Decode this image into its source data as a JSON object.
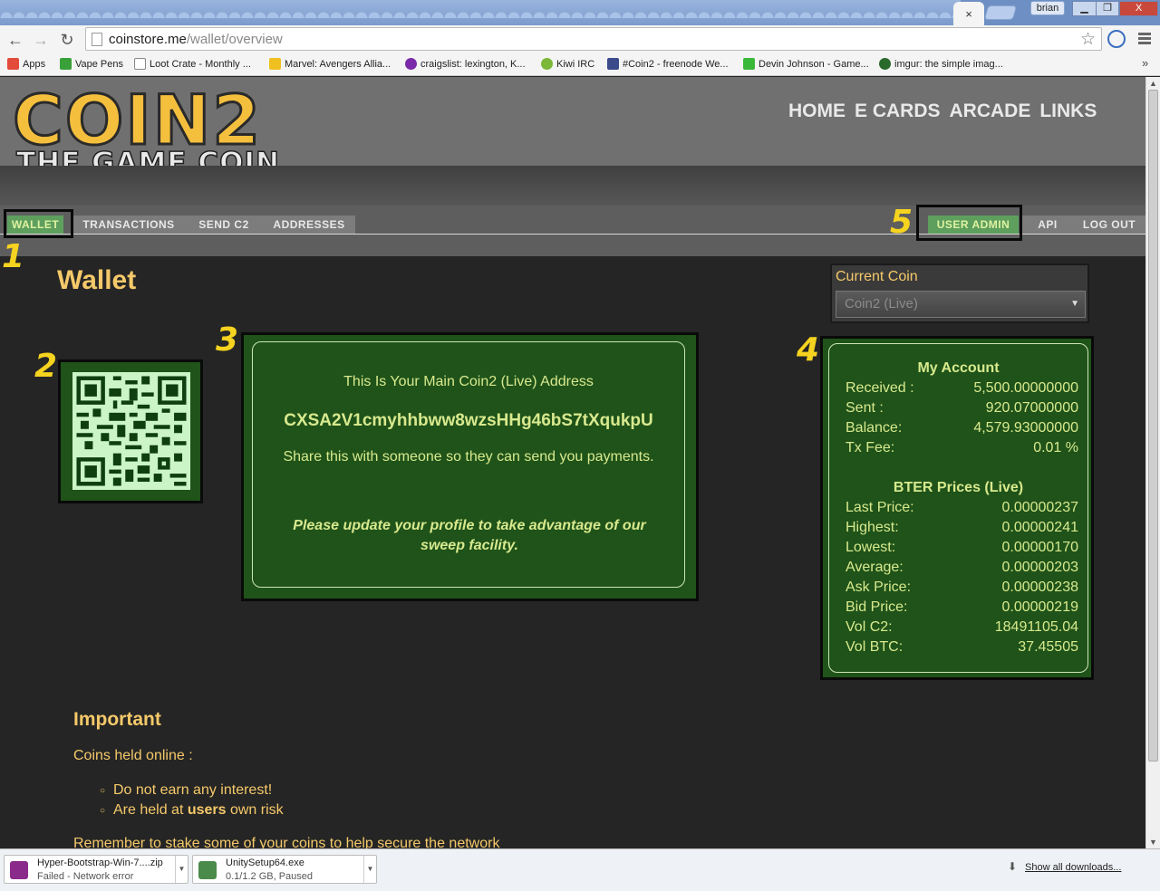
{
  "browser": {
    "active_tab_close": "×",
    "user_name": "brian",
    "window_buttons": [
      "▁",
      "❐",
      "X"
    ],
    "url_host": "coinstore.me",
    "url_path": "/wallet/overview",
    "bookmarks": [
      {
        "label": "Apps",
        "color": "#e34b3b"
      },
      {
        "label": "Vape Pens",
        "color": "#3aa13a"
      },
      {
        "label": "Loot Crate - Monthly ...",
        "color": "#ffffff"
      },
      {
        "label": "Marvel: Avengers Allia...",
        "color": "#f0c020"
      },
      {
        "label": "craigslist: lexington, K...",
        "color": "#7a2aa8"
      },
      {
        "label": "Kiwi IRC",
        "color": "#7bb83a"
      },
      {
        "label": "#Coin2 - freenode We...",
        "color": "#3a4a8a"
      },
      {
        "label": "Devin Johnson - Game...",
        "color": "#3ab83a"
      },
      {
        "label": "imgur: the simple imag...",
        "color": "#2a6a2a"
      }
    ],
    "bookmarks_more": "»"
  },
  "site": {
    "logo_main": "COIN2",
    "logo_sub": "THE GAME COIN",
    "top_nav": [
      "HOME",
      "E CARDS",
      "ARCADE",
      "LINKS"
    ],
    "tabs_left": [
      "WALLET",
      "TRANSACTIONS",
      "SEND C2",
      "ADDRESSES"
    ],
    "tabs_right": [
      "USER ADMIN",
      "API",
      "LOG OUT"
    ],
    "annotations": [
      "1",
      "2",
      "3",
      "4",
      "5"
    ],
    "page_title": "Wallet",
    "current_coin_label": "Current Coin",
    "current_coin_value": "Coin2 (Live)",
    "address": {
      "heading": "This Is Your Main Coin2 (Live) Address",
      "value": "CXSA2V1cmyhhbww8wzsHHg46bS7tXqukpU",
      "share": "Share this with someone so they can send you payments.",
      "notice": "Please update your profile to take advantage of our sweep facility."
    },
    "account": {
      "title": "My Account",
      "rows": [
        {
          "label": "Received :",
          "value": "5,500.00000000"
        },
        {
          "label": "Sent :",
          "value": "920.07000000"
        },
        {
          "label": "Balance:",
          "value": "4,579.93000000"
        },
        {
          "label": "Tx Fee:",
          "value": "0.01 %"
        }
      ]
    },
    "prices": {
      "title": "BTER Prices (Live)",
      "rows": [
        {
          "label": "Last Price:",
          "value": "0.00000237"
        },
        {
          "label": "Highest:",
          "value": "0.00000241"
        },
        {
          "label": "Lowest:",
          "value": "0.00000170"
        },
        {
          "label": "Average:",
          "value": "0.00000203"
        },
        {
          "label": "Ask Price:",
          "value": "0.00000238"
        },
        {
          "label": "Bid Price:",
          "value": "0.00000219"
        },
        {
          "label": "Vol C2:",
          "value": "18491105.04"
        },
        {
          "label": "Vol BTC:",
          "value": "37.45505"
        }
      ]
    },
    "important": {
      "heading": "Important",
      "intro": "Coins held online :",
      "bullet1": "Do not earn any interest!",
      "bullet2_pre": "Are held at ",
      "bullet2_bold": "users",
      "bullet2_post": " own risk",
      "footer": "Remember to stake some of your coins to help secure the network"
    }
  },
  "downloads": {
    "items": [
      {
        "name": "Hyper-Bootstrap-Win-7....zip",
        "status": "Failed - Network error",
        "color": "#8a2a8a"
      },
      {
        "name": "UnitySetup64.exe",
        "status": "0.1/1.2 GB, Paused",
        "color": "#4a8a4a"
      }
    ],
    "show_all": "Show all downloads..."
  }
}
